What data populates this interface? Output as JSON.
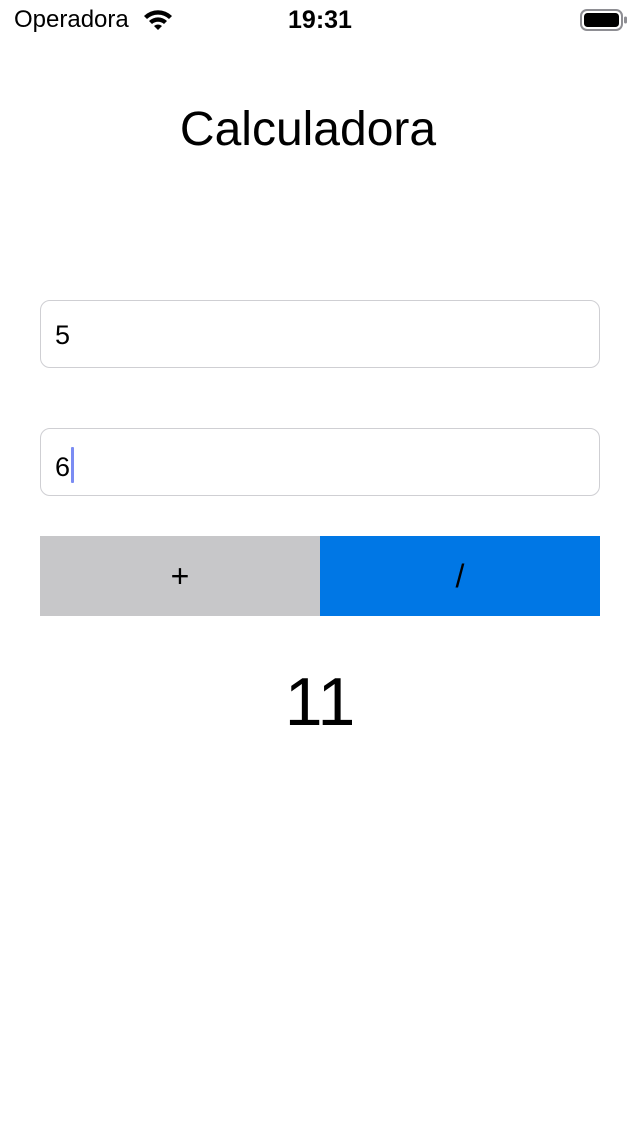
{
  "status_bar": {
    "carrier": "Operadora",
    "time": "19:31",
    "icons": [
      "wifi-icon",
      "battery-icon"
    ]
  },
  "title": "Calculadora",
  "inputs": {
    "first_value": "5",
    "second_value": "6"
  },
  "buttons": {
    "add_label": "+",
    "divide_label": "/"
  },
  "result": "11",
  "colors": {
    "add_button_bg": "#c7c7c9",
    "divide_button_bg": "#0077e5",
    "field_border": "#cfcfd3",
    "caret": "#7b8cf3"
  }
}
